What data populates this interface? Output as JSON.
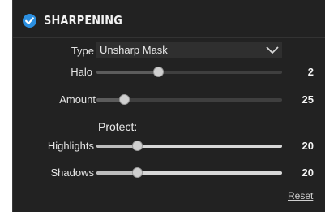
{
  "section": {
    "title": "SHARPENING",
    "enabled": true,
    "accent_color": "#2b8fe0"
  },
  "type": {
    "label": "Type",
    "value": "Unsharp Mask"
  },
  "halo": {
    "label": "Halo",
    "value": "2",
    "level": 0.33
  },
  "amount": {
    "label": "Amount",
    "value": "25",
    "level": 0.15
  },
  "protect": {
    "label": "Protect:",
    "highlights": {
      "label": "Highlights",
      "value": "20",
      "level": 0.22
    },
    "shadows": {
      "label": "Shadows",
      "value": "20",
      "level": 0.22
    }
  },
  "reset_label": "Reset"
}
